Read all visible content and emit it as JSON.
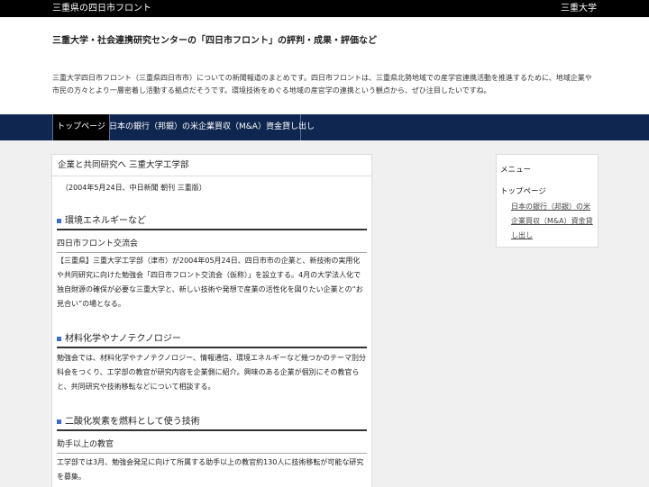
{
  "topbar": {
    "site_name": "三重県の四日市フロント",
    "right_link": "三重大学"
  },
  "header": {
    "title": "三重大学・社会連携研究センターの「四日市フロント」の評判・成果・評価など",
    "description": "三重大学四日市フロント（三重県四日市市）についての新聞報道のまとめです。四日市フロントは、三重県北勢地域での産学官連携活動を推進するために、地域企業や市民の方々とより一層密着し活動する拠点だそうです。環境技術をめぐる地域の産官学の連携という観点から、ぜひ注目したいですね。"
  },
  "nav": [
    {
      "label": "トップページ"
    },
    {
      "label": "日本の銀行（邦銀）の米企業買収（M&A）資金貸し出し"
    }
  ],
  "article": {
    "title": "企業と共同研究へ 三重大学工学部",
    "source": "（2004年5月24日、中日新聞 朝刊 三重版）",
    "sections": [
      {
        "heading": "環境エネルギーなど",
        "subheading": "四日市フロント交流会",
        "text": "【三重県】三重大学工学部（津市）が2004年05月24日、四日市市の企業と、新技術の実用化や共同研究に向けた勉強会「四日市フロント交流会（仮称）」を設立する。4月の大学法人化で独自財源の確保が必要な三重大学と、新しい技術や発想で産業の活性化を図りたい企業との“お見合い”の場となる。"
      },
      {
        "heading": "材料化学やナノテクノロジー",
        "text": "勉強会では、材料化学やナノテクノロジー、情報通信、環境エネルギーなど幾つかのテーマ別分科会をつくり、工学部の教官が研究内容を企業側に紹介。興味のある企業が個別にその教官らと、共同研究や技術移転などについて相談する。"
      },
      {
        "heading": "二酸化炭素を燃料として使う技術",
        "subheading": "助手以上の教官",
        "text": "工学部では3月、勉強会発足に向けて所属する助手以上の教官約130人に技術移転が可能な研究を募集。"
      }
    ]
  },
  "sidebar": {
    "menu_heading": "メニュー",
    "section_heading": "トップページ",
    "link": "日本の銀行（邦銀）の米企業買収（M&A）資金貸し出し"
  },
  "colors": {
    "nav_bg": "#0f2750",
    "accent_square": "#3a6fc4",
    "topbar_bg": "#000000"
  }
}
